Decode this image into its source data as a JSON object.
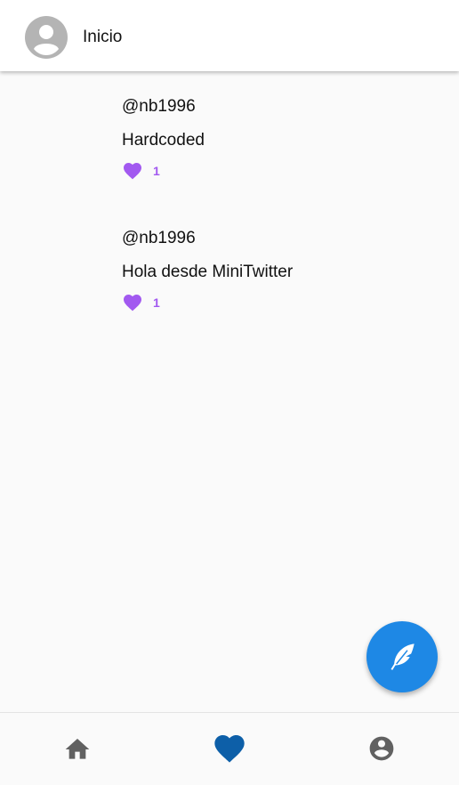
{
  "app": {
    "title": "Inicio",
    "avatar_icon": "account-circle-icon"
  },
  "feed": {
    "posts": [
      {
        "username": "@nb1996",
        "text": "Hardcoded",
        "likes": "1"
      },
      {
        "username": "@nb1996",
        "text": "Hola desde MiniTwitter",
        "likes": "1"
      }
    ]
  },
  "fab": {
    "icon": "feather-icon",
    "color": "#1e88e5"
  },
  "bottom_nav": {
    "items": [
      {
        "icon": "home-icon",
        "active": false
      },
      {
        "icon": "heart-icon",
        "active": true
      },
      {
        "icon": "account-circle-icon",
        "active": false
      }
    ],
    "active_color": "#0d5fa8",
    "inactive_color": "#616161"
  },
  "colors": {
    "like": "#a259f0",
    "avatar": "#b4b4b4"
  }
}
